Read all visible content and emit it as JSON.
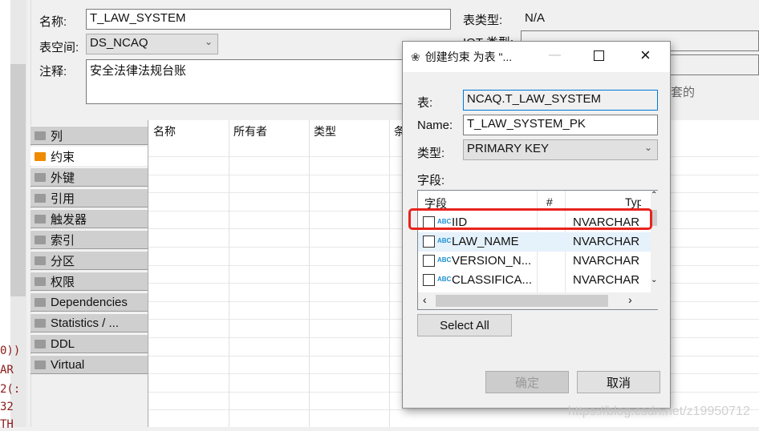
{
  "background_code": [
    "0))",
    "AR",
    "2(:",
    "32",
    "TH"
  ],
  "form": {
    "name_label": "名称:",
    "name_value": "T_LAW_SYSTEM",
    "tablespace_label": "表空间:",
    "tablespace_value": "DS_NCAQ",
    "comment_label": "注释:",
    "comment_value": "安全法律法规台账",
    "table_type_label": "表类型:",
    "table_type_value": "N/A",
    "iot_type_label": "IOT 类型:",
    "partial_text": "套的"
  },
  "nav": {
    "items": [
      {
        "label": "列",
        "icon": "columns-icon"
      },
      {
        "label": "约束",
        "icon": "constraint-icon",
        "active": true
      },
      {
        "label": "外键",
        "icon": "folder-icon"
      },
      {
        "label": "引用",
        "icon": "folder-icon"
      },
      {
        "label": "触发器",
        "icon": "folder-icon"
      },
      {
        "label": "索引",
        "icon": "folder-icon"
      },
      {
        "label": "分区",
        "icon": "folder-icon"
      },
      {
        "label": "权限",
        "icon": "key-icon"
      },
      {
        "label": "Dependencies",
        "icon": "folder-icon"
      },
      {
        "label": "Statistics / ...",
        "icon": "info-icon"
      },
      {
        "label": "DDL",
        "icon": "ddl-icon"
      },
      {
        "label": "Virtual",
        "icon": "virtual-icon"
      }
    ]
  },
  "grid": {
    "headers": [
      "名称",
      "所有者",
      "类型",
      "条"
    ]
  },
  "dialog": {
    "title": "创建约束 为表 \"...",
    "table_label": "表:",
    "table_value": "NCAQ.T_LAW_SYSTEM",
    "name_label": "Name:",
    "name_value": "T_LAW_SYSTEM_PK",
    "type_label": "类型:",
    "type_value": "PRIMARY KEY",
    "fields_label": "字段:",
    "columns": [
      "字段",
      "#",
      "Typ"
    ],
    "rows": [
      {
        "name": "IID",
        "type": "NVARCHAR",
        "checked": false,
        "highlighted": true
      },
      {
        "name": "LAW_NAME",
        "type": "NVARCHAR",
        "checked": false
      },
      {
        "name": "VERSION_N...",
        "type": "NVARCHAR",
        "checked": false
      },
      {
        "name": "CLASSIFICA...",
        "type": "NVARCHAR",
        "checked": false
      }
    ],
    "select_all": "Select All",
    "ok": "确定",
    "cancel": "取消",
    "highlight_color": "#e8231d"
  },
  "watermark": "https://blog.csdn.net/z19950712"
}
